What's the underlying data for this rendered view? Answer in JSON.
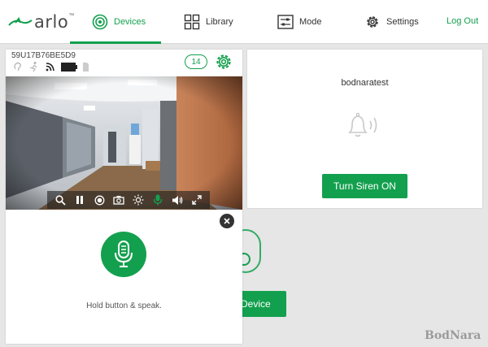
{
  "header": {
    "logo_text": "arlo",
    "logo_mark": "™",
    "nav": {
      "devices": "Devices",
      "library": "Library",
      "mode": "Mode",
      "settings": "Settings"
    },
    "logout": "Log Out"
  },
  "camera": {
    "device_id": "59U17B76BE5D9",
    "clip_count": "14",
    "status_icons": [
      "audio-icon",
      "motion-icon",
      "wifi-icon",
      "battery-icon",
      "sd-card-icon"
    ],
    "controls": [
      "zoom-icon",
      "pause-icon",
      "record-icon",
      "snapshot-icon",
      "brightness-icon",
      "microphone-icon",
      "speaker-icon",
      "fullscreen-icon"
    ]
  },
  "talk": {
    "hint": "Hold button & speak."
  },
  "siren": {
    "name": "bodnaratest",
    "button_label": "Turn Siren ON"
  },
  "background": {
    "add_device_partial": "Device"
  },
  "watermark": "BodNara",
  "colors": {
    "accent": "#13A04E",
    "bg": "#e6e6e6"
  }
}
